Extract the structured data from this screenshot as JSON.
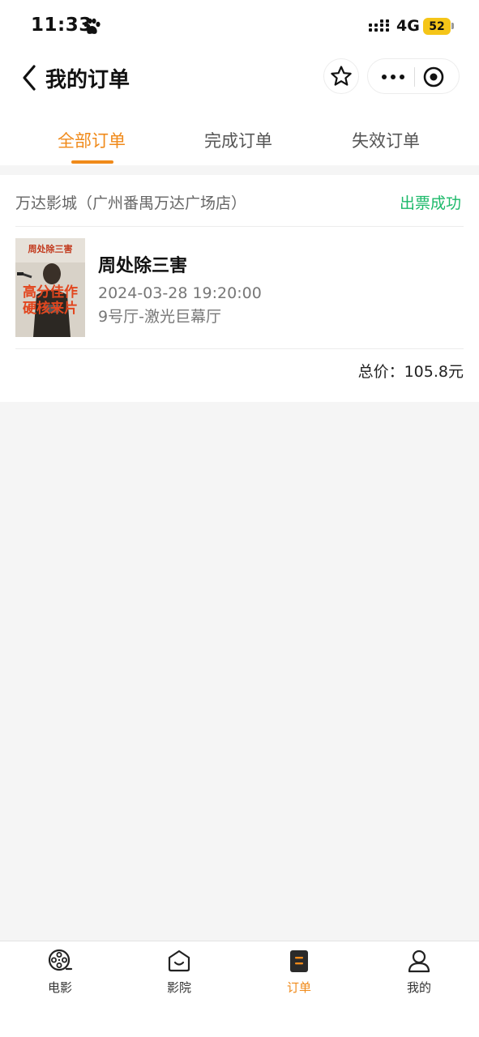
{
  "status_bar": {
    "time": "11:33",
    "network": "4G",
    "battery": "52"
  },
  "header": {
    "title": "我的订单"
  },
  "tabs": [
    {
      "label": "全部订单",
      "active": true
    },
    {
      "label": "完成订单",
      "active": false
    },
    {
      "label": "失效订单",
      "active": false
    }
  ],
  "order": {
    "cinema": "万达影城（广州番禺万达广场店）",
    "status": "出票成功",
    "movie_title": "周处除三害",
    "showtime": "2024-03-28 19:20:00",
    "hall": "9号厅-激光巨幕厅",
    "total": "总价：105.8元",
    "poster": {
      "top_text": "周处除三害",
      "slogan_line1": "高分佳作",
      "slogan_line2": "硬核来片"
    }
  },
  "bottom_nav": [
    {
      "label": "电影",
      "icon": "film-reel-icon",
      "active": false
    },
    {
      "label": "影院",
      "icon": "cinema-icon",
      "active": false
    },
    {
      "label": "订单",
      "icon": "order-icon",
      "active": true
    },
    {
      "label": "我的",
      "icon": "user-icon",
      "active": false
    }
  ],
  "colors": {
    "accent": "#f08a1a",
    "success": "#1cb96a",
    "battery": "#f5c518"
  }
}
